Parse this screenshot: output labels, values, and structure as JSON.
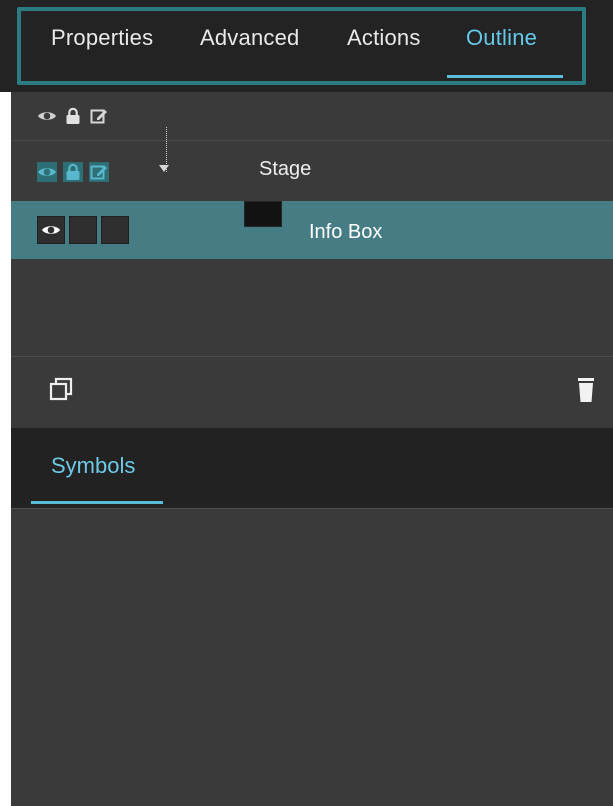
{
  "tabs": {
    "items": [
      {
        "label": "Properties",
        "active": false
      },
      {
        "label": "Advanced",
        "active": false
      },
      {
        "label": "Actions",
        "active": false
      },
      {
        "label": "Outline",
        "active": true
      }
    ],
    "active_color": "#65c8e8"
  },
  "outline": {
    "rows": [
      {
        "label": "",
        "visible_icon": "eye-icon",
        "lock_icon": "lock-icon",
        "edit_icon": "edit-icon"
      },
      {
        "label": "Stage",
        "visible_icon": "eye-icon",
        "lock_icon": "lock-icon",
        "edit_icon": "edit-icon",
        "expanded": true
      },
      {
        "label": "Info Box",
        "visible_icon": "eye-icon",
        "selected": true
      }
    ],
    "toolbar": {
      "left_icon": "duplicate-icon",
      "right_icon": "trash-icon"
    }
  },
  "symbols": {
    "tab_label": "Symbols"
  },
  "colors": {
    "panel_bg": "#3a3a3a",
    "header_bg": "#232323",
    "selection_bg": "#467d85",
    "accent": "#57bdd9",
    "highlight_border": "#2b7c82"
  }
}
